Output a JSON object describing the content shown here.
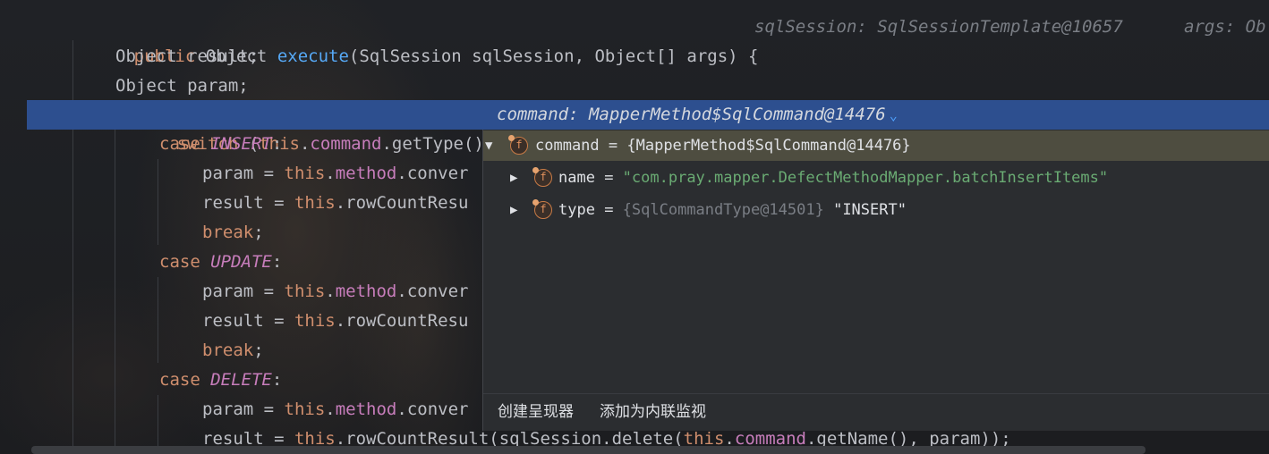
{
  "code": {
    "line1": {
      "kw_public": "public",
      "type_object": "Object",
      "method_name": "execute",
      "params": "(SqlSession sqlSession, Object[] args) {",
      "hint_sqlsession": "sqlSession: SqlSessionTemplate@10657",
      "hint_args": "args: Ob"
    },
    "line2": "Object result;",
    "line3": "Object param;",
    "line4": {
      "kw_switch": "switch",
      "open_paren": "(",
      "kw_this": "this",
      "dot1": ".",
      "field_command": "command",
      "rest": ".getType())",
      "brace": "{",
      "inline_value": "command: MapperMethod$SqlCommand@14476"
    },
    "case_kw": "case",
    "enum_insert": "INSERT",
    "enum_update": "UPDATE",
    "enum_delete": "DELETE",
    "colon": ":",
    "param_assign": "param = ",
    "result_assign": "result = ",
    "this_kw": "this",
    "dot": ".",
    "method_field": "method",
    "convert_trunc": ".conver",
    "rowcount_trunc": ".rowCountResu",
    "break_kw": "break",
    "semicolon": ";",
    "last_line": {
      "prefix": ".rowCountResult(sqlSession.delete(",
      "this_kw": "this",
      "dot": ".",
      "command": "command",
      "suffix": ".getName(), param));"
    }
  },
  "debug_popup": {
    "root": {
      "name": "command",
      "eq": " = ",
      "value": "{MapperMethod$SqlCommand@14476}"
    },
    "children": [
      {
        "name": "name",
        "eq": " = ",
        "value": "\"com.pray.mapper.DefectMethodMapper.batchInsertItems\""
      },
      {
        "name": "type",
        "eq": " = ",
        "ref": "{SqlCommandType@14501}",
        "value": " \"INSERT\""
      }
    ],
    "field_icon_letter": "f",
    "footer": {
      "create_renderer": "创建呈现器",
      "add_inline_watch": "添加为内联监视"
    }
  },
  "icons": {
    "expanded": "expanded-arrow-icon",
    "collapsed": "collapsed-arrow-icon",
    "field": "field-icon",
    "chevron": "chevron-down-icon"
  },
  "colors": {
    "current_line": "#2d4f8f",
    "keyword": "#cf8e6d",
    "function": "#56a8f5",
    "field": "#c77dbb",
    "string": "#6aab73",
    "popup_bg": "#2b2d30",
    "selected_row": "#4e4d40"
  }
}
